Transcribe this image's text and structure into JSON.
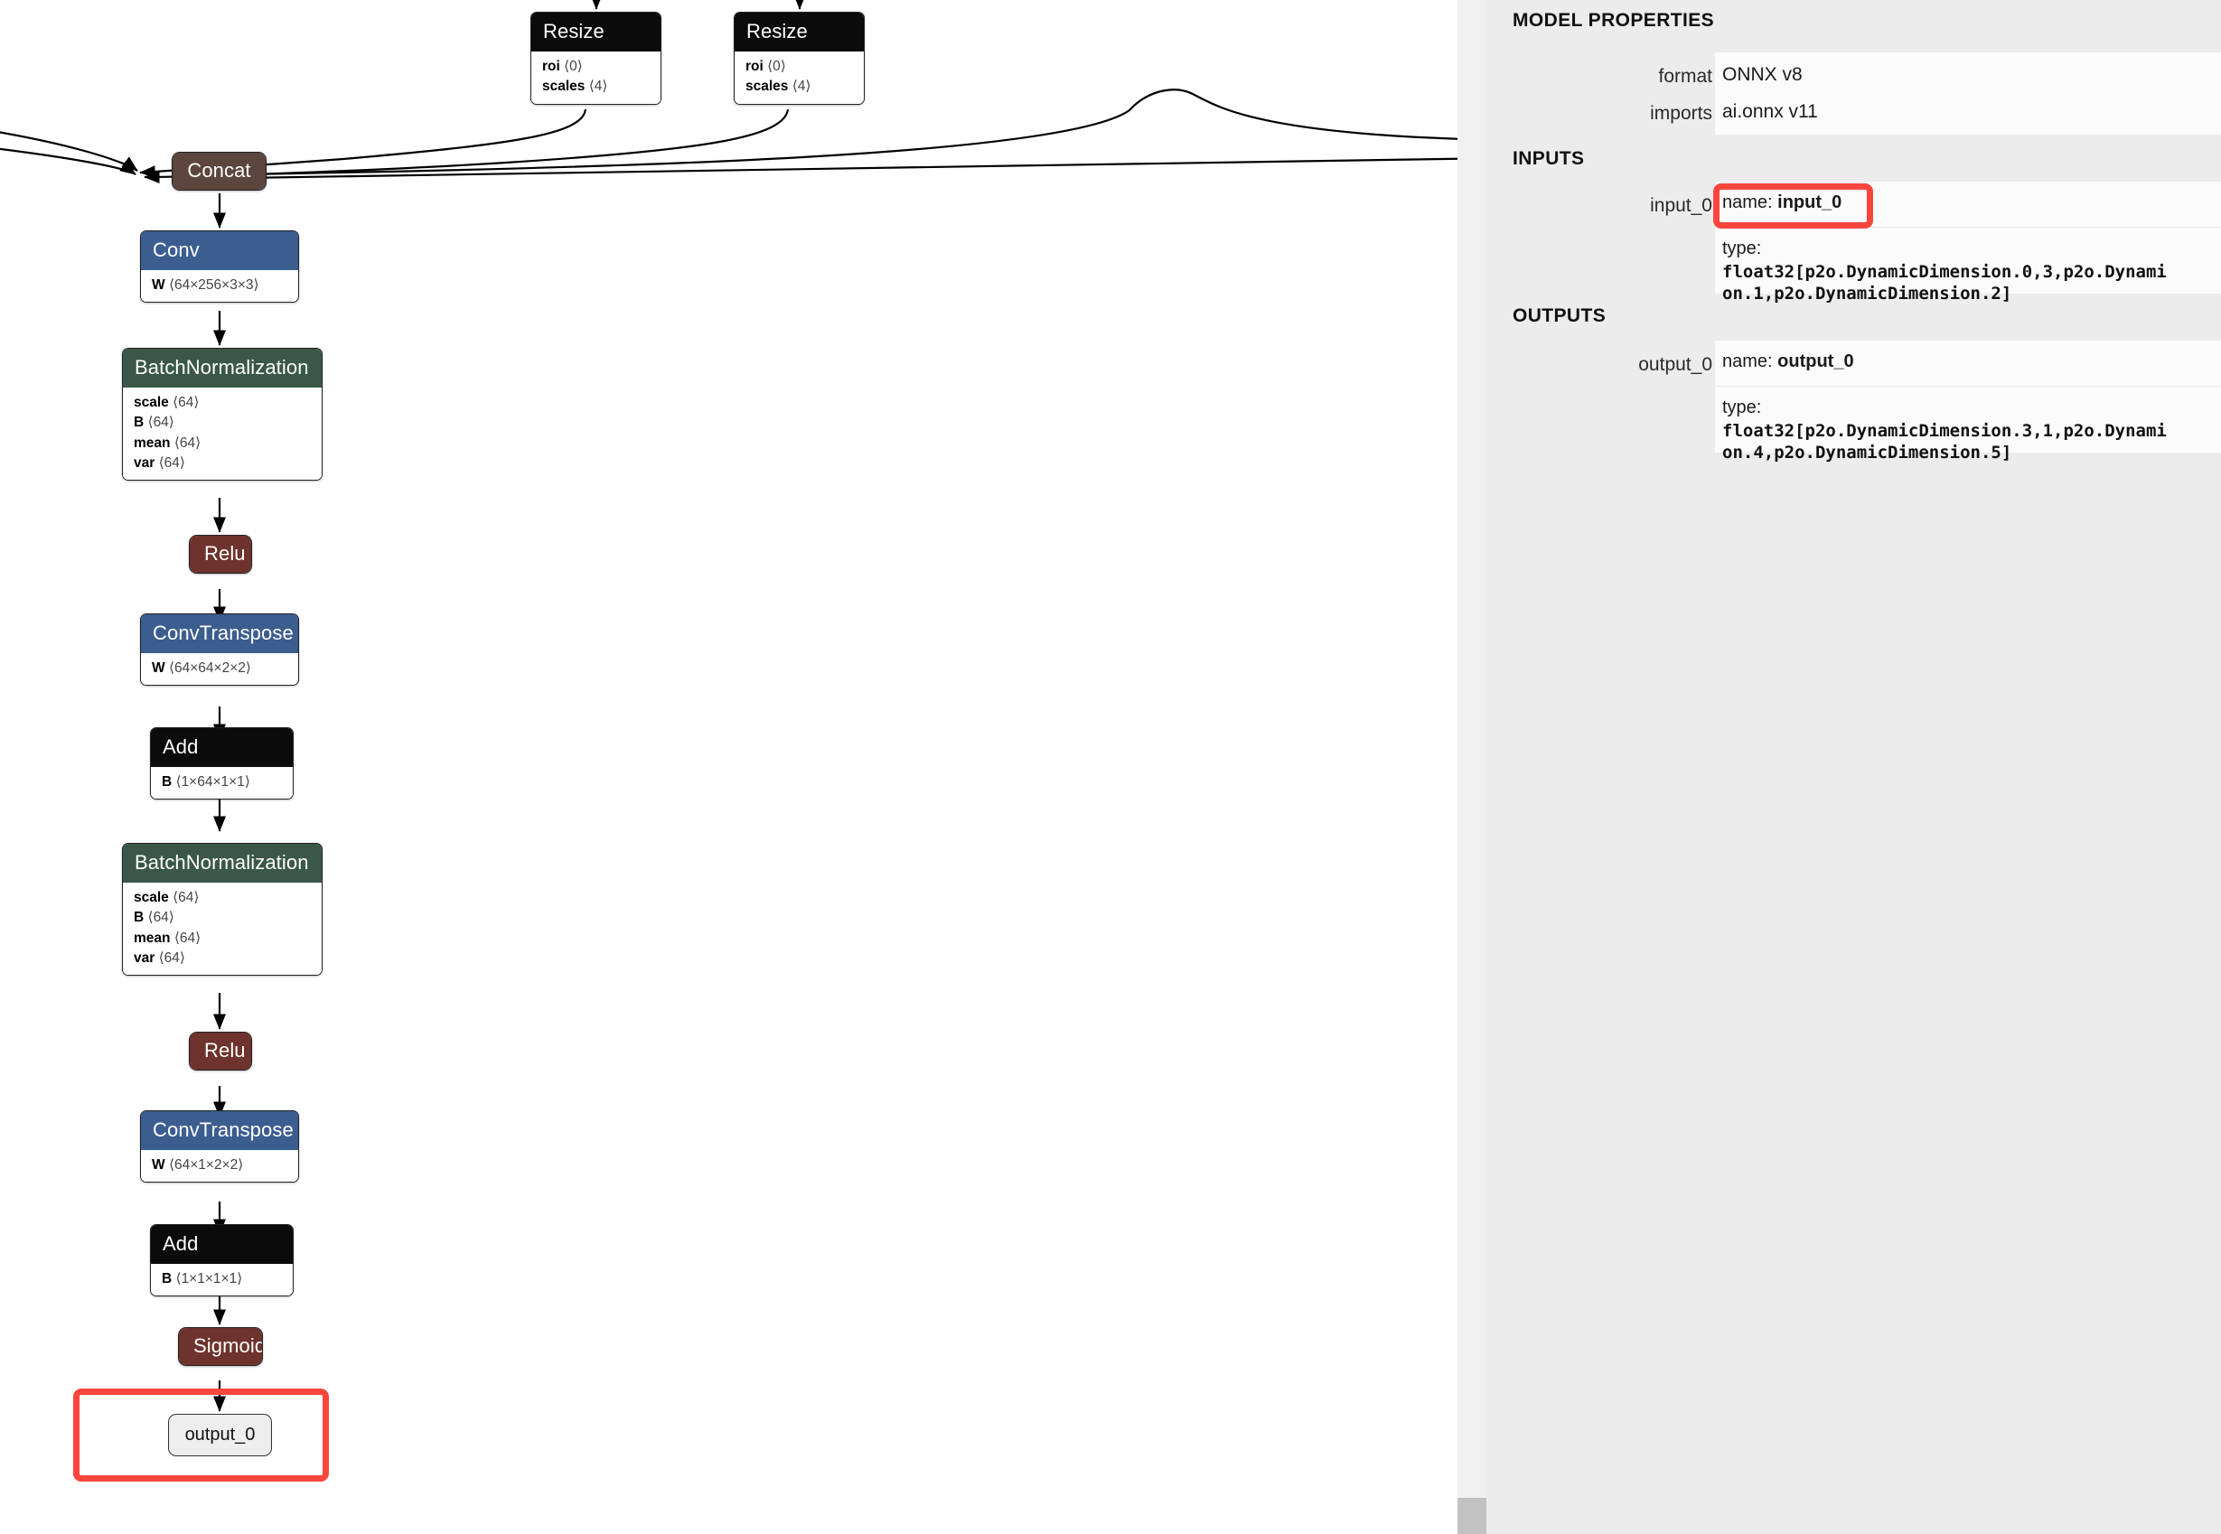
{
  "app": "Netron",
  "graph": {
    "nodes": [
      {
        "id": "resize_1",
        "type": "Resize",
        "color": "black",
        "attributes": [
          {
            "name": "roi",
            "value": "⟨0⟩"
          },
          {
            "name": "scales",
            "value": "⟨4⟩"
          }
        ]
      },
      {
        "id": "resize_2",
        "type": "Resize",
        "color": "black",
        "attributes": [
          {
            "name": "roi",
            "value": "⟨0⟩"
          },
          {
            "name": "scales",
            "value": "⟨4⟩"
          }
        ]
      },
      {
        "id": "concat_1",
        "type": "Concat",
        "color": "brown",
        "attributes": []
      },
      {
        "id": "conv_1",
        "type": "Conv",
        "color": "blue",
        "attributes": [
          {
            "name": "W",
            "value": "⟨64×256×3×3⟩"
          }
        ]
      },
      {
        "id": "batchnorm_1",
        "type": "BatchNormalization",
        "color": "green",
        "attributes": [
          {
            "name": "scale",
            "value": "⟨64⟩"
          },
          {
            "name": "B",
            "value": "⟨64⟩"
          },
          {
            "name": "mean",
            "value": "⟨64⟩"
          },
          {
            "name": "var",
            "value": "⟨64⟩"
          }
        ]
      },
      {
        "id": "relu_1",
        "type": "Relu",
        "color": "red",
        "attributes": []
      },
      {
        "id": "convtranspose_1",
        "type": "ConvTranspose",
        "color": "blue",
        "attributes": [
          {
            "name": "W",
            "value": "⟨64×64×2×2⟩"
          }
        ]
      },
      {
        "id": "add_1",
        "type": "Add",
        "color": "black",
        "attributes": [
          {
            "name": "B",
            "value": "⟨1×64×1×1⟩"
          }
        ]
      },
      {
        "id": "batchnorm_2",
        "type": "BatchNormalization",
        "color": "green",
        "attributes": [
          {
            "name": "scale",
            "value": "⟨64⟩"
          },
          {
            "name": "B",
            "value": "⟨64⟩"
          },
          {
            "name": "mean",
            "value": "⟨64⟩"
          },
          {
            "name": "var",
            "value": "⟨64⟩"
          }
        ]
      },
      {
        "id": "relu_2",
        "type": "Relu",
        "color": "red",
        "attributes": []
      },
      {
        "id": "convtranspose_2",
        "type": "ConvTranspose",
        "color": "blue",
        "attributes": [
          {
            "name": "W",
            "value": "⟨64×1×2×2⟩"
          }
        ]
      },
      {
        "id": "add_2",
        "type": "Add",
        "color": "black",
        "attributes": [
          {
            "name": "B",
            "value": "⟨1×1×1×1⟩"
          }
        ]
      },
      {
        "id": "sigmoid_1",
        "type": "Sigmoid",
        "color": "red",
        "attributes": []
      }
    ],
    "output_node": {
      "label": "output_0"
    },
    "highlight_color": "#f9463c"
  },
  "sidebar": {
    "sections": {
      "model_properties": "MODEL PROPERTIES",
      "inputs": "INPUTS",
      "outputs": "OUTPUTS"
    },
    "properties": [
      {
        "label": "format",
        "value": "ONNX v8"
      },
      {
        "label": "imports",
        "value": "ai.onnx v11"
      }
    ],
    "inputs": [
      {
        "label": "input_0",
        "name_prefix": "name: ",
        "name_value": "input_0",
        "type_label": "type:",
        "type_line_1": "float32[p2o.DynamicDimension.0,3,p2o.Dynami",
        "type_line_2": "on.1,p2o.DynamicDimension.2]"
      }
    ],
    "outputs": [
      {
        "label": "output_0",
        "name_prefix": "name: ",
        "name_value": "output_0",
        "type_label": "type:",
        "type_line_1": "float32[p2o.DynamicDimension.3,1,p2o.Dynami",
        "type_line_2": "on.4,p2o.DynamicDimension.5]"
      }
    ]
  }
}
